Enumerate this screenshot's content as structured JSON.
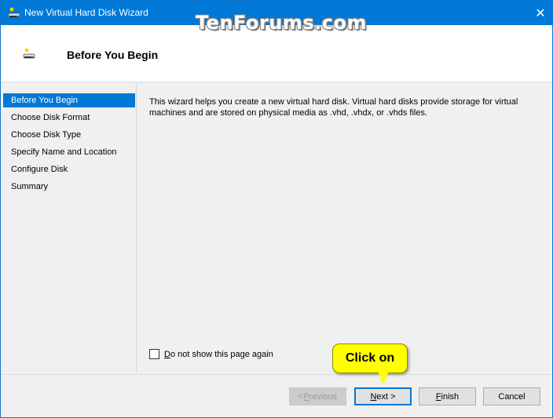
{
  "window": {
    "title": "New Virtual Hard Disk Wizard",
    "watermark": "TenForums.com"
  },
  "header": {
    "title": "Before You Begin"
  },
  "sidebar": {
    "items": [
      {
        "label": "Before You Begin",
        "selected": true
      },
      {
        "label": "Choose Disk Format",
        "selected": false
      },
      {
        "label": "Choose Disk Type",
        "selected": false
      },
      {
        "label": "Specify Name and Location",
        "selected": false
      },
      {
        "label": "Configure Disk",
        "selected": false
      },
      {
        "label": "Summary",
        "selected": false
      }
    ]
  },
  "content": {
    "description": "This wizard helps you create a new virtual hard disk. Virtual hard disks provide storage for virtual machines and are stored on physical media as .vhd, .vhdx, or .vhds files."
  },
  "checkbox": {
    "label_first": "D",
    "label_rest": "o not show this page again",
    "checked": false
  },
  "buttons": {
    "previous_prefix": "< ",
    "previous_accel": "P",
    "previous_rest": "revious",
    "next_accel": "N",
    "next_rest": "ext >",
    "finish_accel": "F",
    "finish_rest": "inish",
    "cancel": "Cancel"
  },
  "annotation": {
    "callout": "Click on"
  },
  "colors": {
    "accent": "#0078d7",
    "callout": "#ffff00"
  }
}
